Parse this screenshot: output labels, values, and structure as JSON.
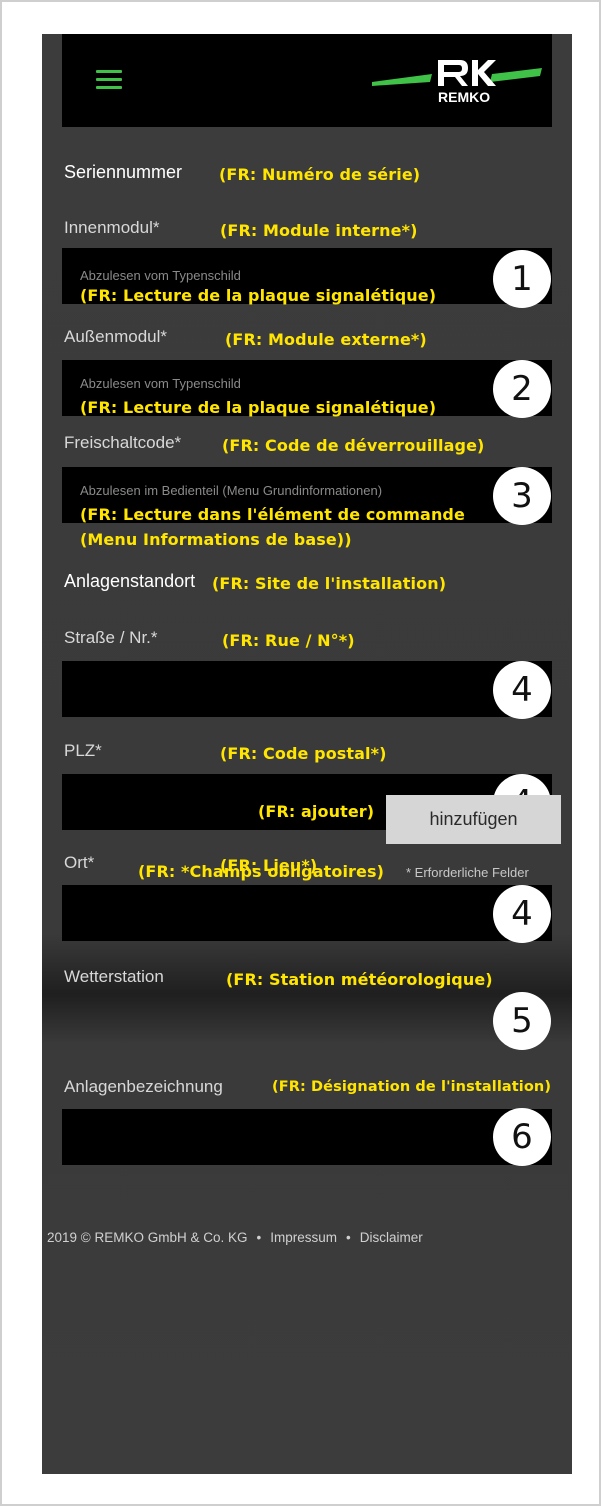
{
  "header": {
    "menu_icon": "hamburger-icon",
    "logo_text": "REMKO",
    "accent_color": "#3fc247"
  },
  "serial": {
    "title": "Seriennummer",
    "title_fr": "(FR: Numéro de série)"
  },
  "indoor": {
    "label": "Innenmodul*",
    "label_fr": "(FR: Module interne*)",
    "placeholder": "Abzulesen vom Typenschild",
    "placeholder_fr": "(FR: Lecture de la plaque signalétique)",
    "marker": "1"
  },
  "outdoor": {
    "label": "Außenmodul*",
    "label_fr": "(FR: Module externe*)",
    "placeholder": "Abzulesen vom Typenschild",
    "placeholder_fr": "(FR: Lecture de la plaque signalétique)",
    "marker": "2"
  },
  "unlock": {
    "label": "Freischaltcode*",
    "label_fr": "(FR: Code de déverrouillage)",
    "placeholder": "Abzulesen im Bedienteil (Menu Grundinformationen)",
    "placeholder_fr_line1": "(FR: Lecture dans l'élément de commande",
    "placeholder_fr_line2": "(Menu Informations de base))",
    "marker": "3"
  },
  "site": {
    "title": "Anlagenstandort",
    "title_fr": "(FR: Site de l'installation)"
  },
  "street": {
    "label": "Straße / Nr.*",
    "label_fr": "(FR: Rue / N°*)",
    "value": "",
    "marker": "4"
  },
  "zip": {
    "label": "PLZ*",
    "label_fr": "(FR: Code postal*)",
    "value": "",
    "marker": "4"
  },
  "city": {
    "label": "Ort*",
    "label_fr": "(FR: Lieu*)",
    "value": "",
    "marker": "4"
  },
  "weather": {
    "label": "Wetterstation",
    "label_fr": "(FR: Station météorologique)",
    "marker": "5"
  },
  "designation": {
    "label": "Anlagenbezeichnung",
    "label_fr": "(FR: Désignation de l'installation)",
    "value": "",
    "marker": "6"
  },
  "actions": {
    "add_label": "hinzufügen",
    "add_label_fr": "(FR: ajouter)",
    "required_note": "* Erforderliche Felder",
    "required_note_fr": "(FR: *Champs obligatoires)"
  },
  "footer": {
    "copyright": "2019 © REMKO GmbH & Co. KG",
    "separator": "•",
    "imprint": "Impressum",
    "disclaimer": "Disclaimer"
  }
}
